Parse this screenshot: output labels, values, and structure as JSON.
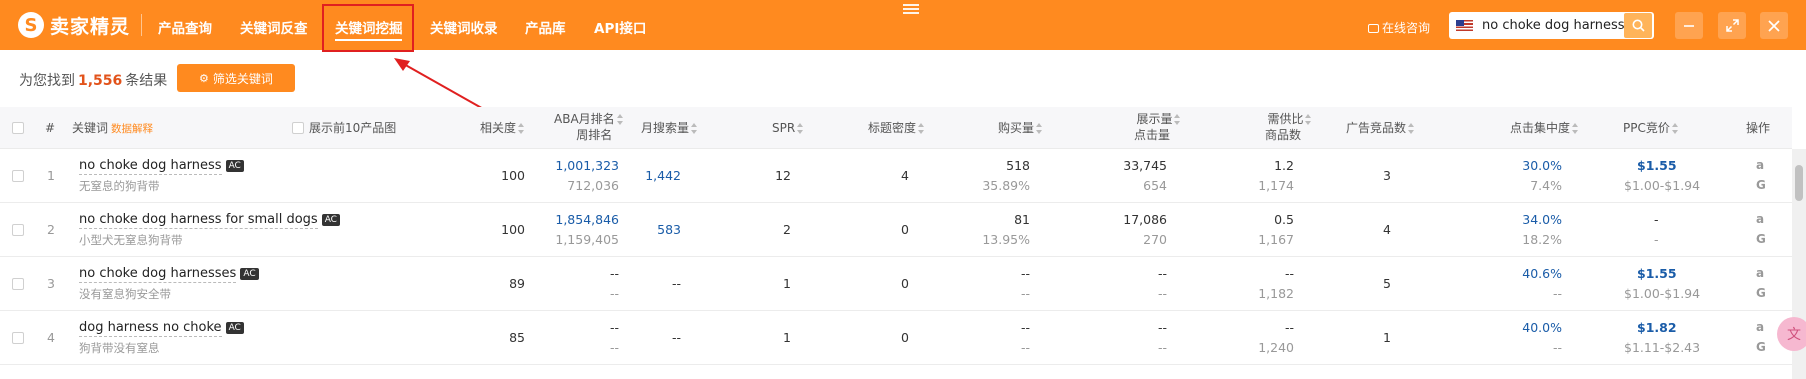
{
  "brand": {
    "logo_glyph": "S",
    "name": "卖家精灵"
  },
  "nav": [
    {
      "label": "产品查询"
    },
    {
      "label": "关键词反查"
    },
    {
      "label": "关键词挖掘"
    },
    {
      "label": "关键词收录"
    },
    {
      "label": "产品库"
    },
    {
      "label": "API接口"
    }
  ],
  "active_nav": "关键词挖掘",
  "header": {
    "consult_label": "在线咨询",
    "search_value": "no choke dog harness",
    "marketplace_flag": "us-flag-icon"
  },
  "results": {
    "prefix": "为您找到",
    "count": "1,556",
    "suffix": "条结果",
    "filter_label": "筛选关键词"
  },
  "table": {
    "headers": {
      "index": "#",
      "keyword": "关键词",
      "keyword_hint": "数据解释",
      "show_top10": "展示前10产品图",
      "relevance": "相关度",
      "aba_line1": "ABA月排名",
      "aba_line2": "周排名",
      "monthly_search": "月搜索量",
      "spr": "SPR",
      "title_density": "标题密度",
      "purchases": "购买量",
      "impressions_line1": "展示量",
      "impressions_line2": "点击量",
      "supply_line1": "需供比",
      "supply_line2": "商品数",
      "ad_products": "广告竞品数",
      "click_concentration": "点击集中度",
      "ppc": "PPC竞价",
      "actions": "操作"
    },
    "rows": [
      {
        "index": "1",
        "keyword": "no choke dog harness",
        "badge": "AC",
        "translation": "无窒息的狗背带",
        "relevance": "100",
        "aba_month": "1,001,323",
        "aba_week": "712,036",
        "monthly_search": "1,442",
        "spr": "12",
        "title_density": "4",
        "purchases": "518",
        "purchase_rate": "35.89%",
        "impressions": "33,745",
        "clicks": "654",
        "supply_ratio": "1.2",
        "products": "1,174",
        "ad_products": "3",
        "click_concentration": "30.0%",
        "click_share": "7.4%",
        "ppc": "$1.55",
        "ppc_range": "$1.00-$1.94"
      },
      {
        "index": "2",
        "keyword": "no choke dog harness for small dogs",
        "badge": "AC",
        "translation": "小型犬无窒息狗背带",
        "relevance": "100",
        "aba_month": "1,854,846",
        "aba_week": "1,159,405",
        "monthly_search": "583",
        "spr": "2",
        "title_density": "0",
        "purchases": "81",
        "purchase_rate": "13.95%",
        "impressions": "17,086",
        "clicks": "270",
        "supply_ratio": "0.5",
        "products": "1,167",
        "ad_products": "4",
        "click_concentration": "34.0%",
        "click_share": "18.2%",
        "ppc": "-",
        "ppc_range": "-"
      },
      {
        "index": "3",
        "keyword": "no choke dog harnesses",
        "badge": "AC",
        "translation": "没有窒息狗安全带",
        "relevance": "89",
        "aba_month": "--",
        "aba_week": "--",
        "monthly_search": "--",
        "spr": "1",
        "title_density": "0",
        "purchases": "--",
        "purchase_rate": "--",
        "impressions": "--",
        "clicks": "--",
        "supply_ratio": "--",
        "products": "1,182",
        "ad_products": "5",
        "click_concentration": "40.6%",
        "click_share": "--",
        "ppc": "$1.55",
        "ppc_range": "$1.00-$1.94"
      },
      {
        "index": "4",
        "keyword": "dog harness no choke",
        "badge": "AC",
        "translation": "狗背带没有窒息",
        "relevance": "85",
        "aba_month": "--",
        "aba_week": "--",
        "monthly_search": "--",
        "spr": "1",
        "title_density": "0",
        "purchases": "--",
        "purchase_rate": "--",
        "impressions": "--",
        "clicks": "--",
        "supply_ratio": "--",
        "products": "1,240",
        "ad_products": "1",
        "click_concentration": "40.0%",
        "click_share": "--",
        "ppc": "$1.82",
        "ppc_range": "$1.11-$2.43"
      }
    ],
    "row_actions": [
      "a",
      "G"
    ]
  },
  "colors": {
    "brand_orange": "#ff8a1f",
    "link_blue": "#1a5ca8",
    "highlight_red": "#e02020",
    "count_red": "#e2531b"
  }
}
